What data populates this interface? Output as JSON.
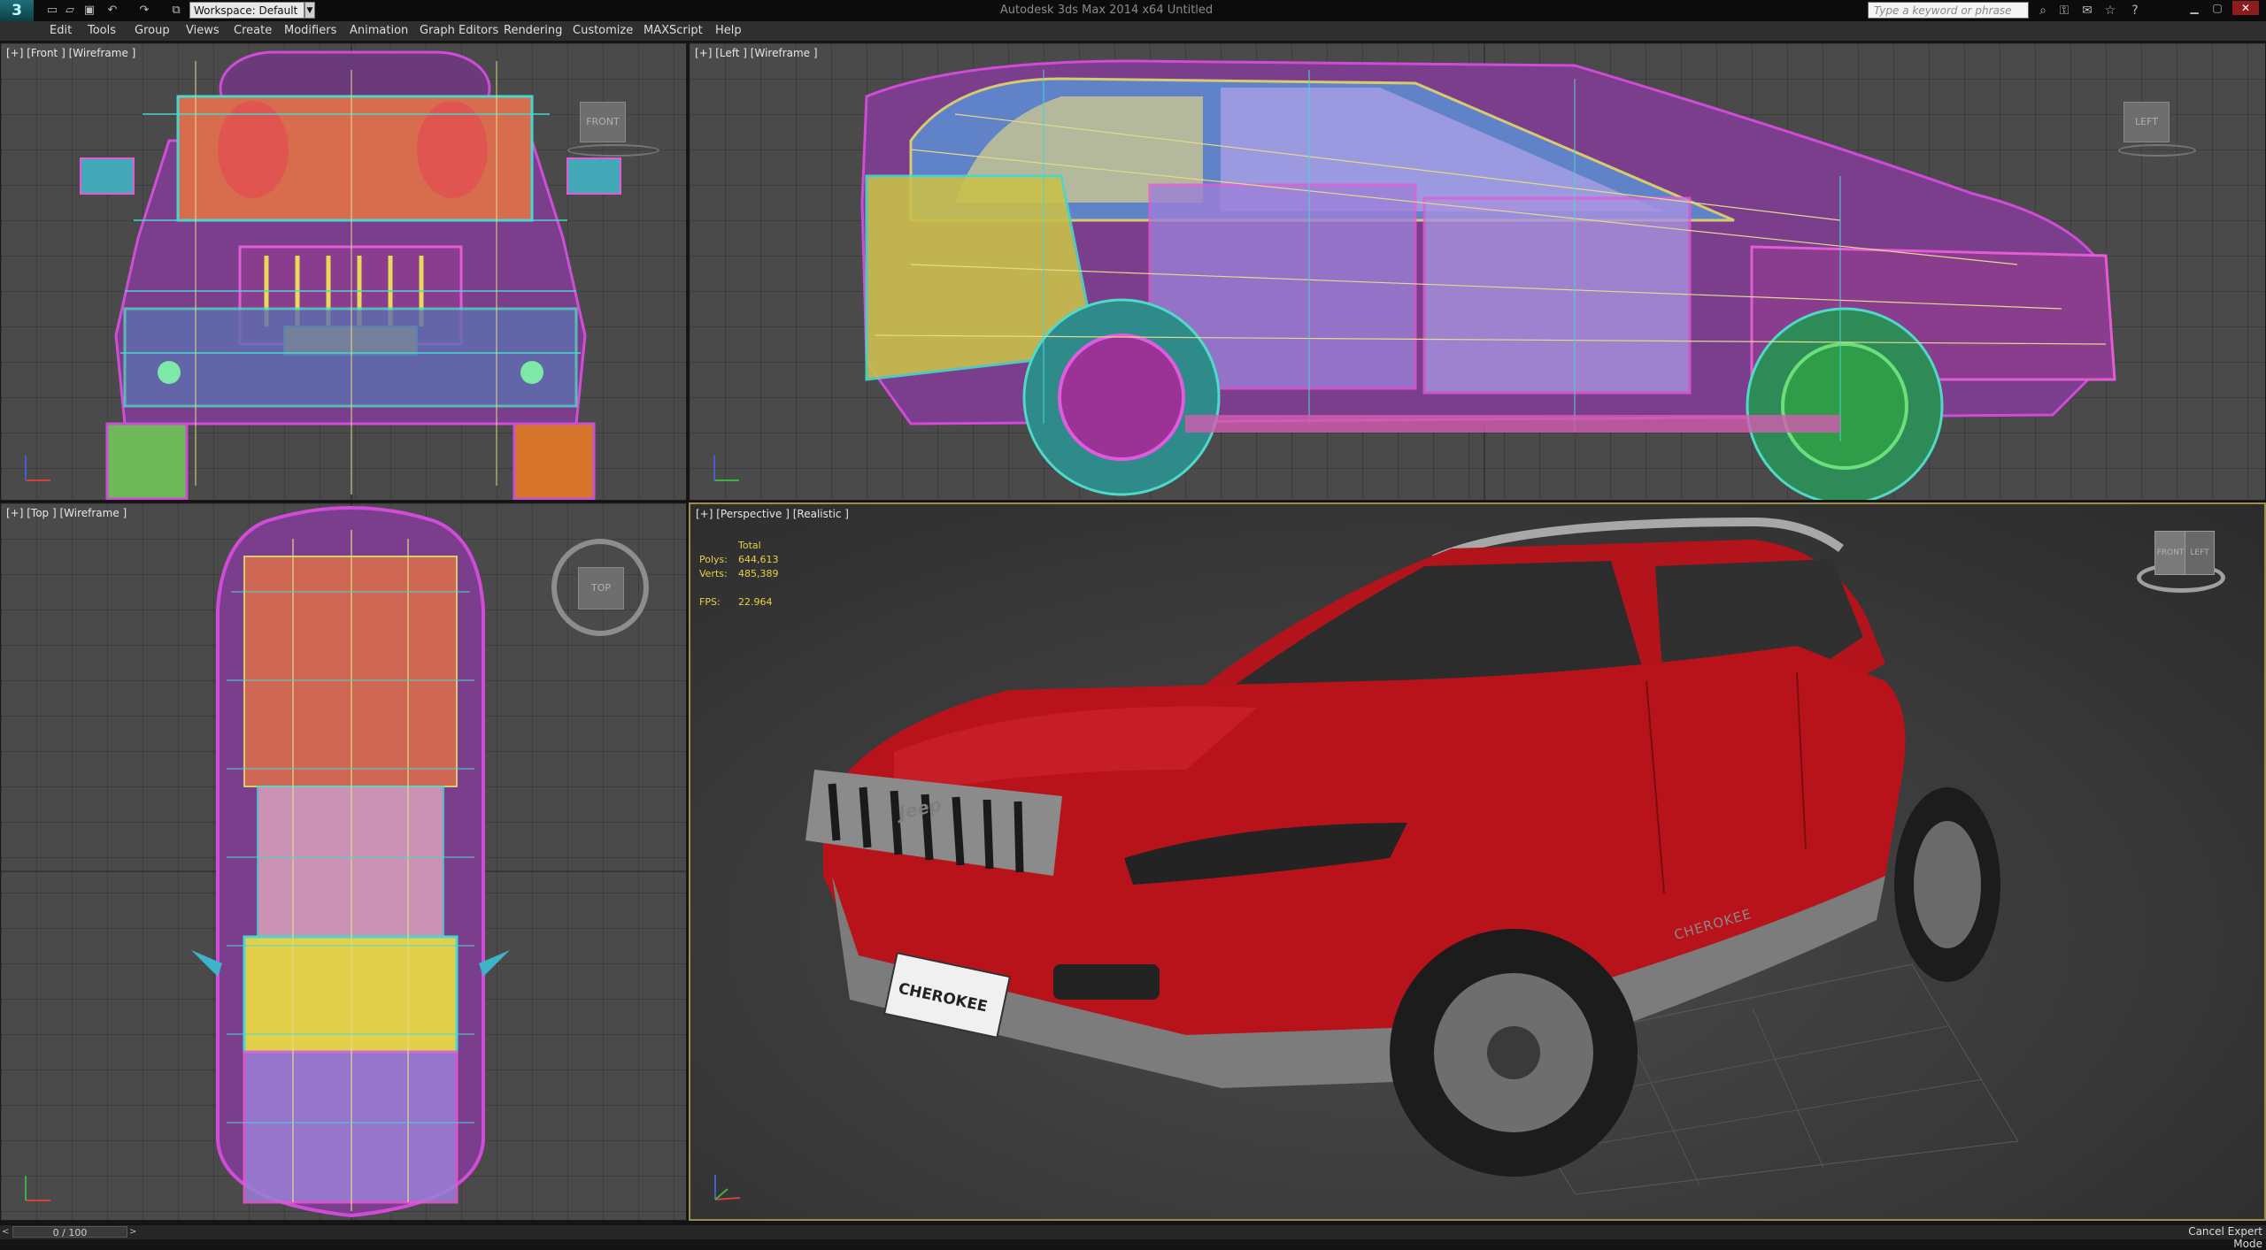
{
  "app": {
    "title": "Autodesk 3ds Max 2014 x64     Untitled",
    "logo": "3"
  },
  "toolbar": {
    "workspace": "Workspace: Default",
    "search_placeholder": "Type a keyword or phrase"
  },
  "quick_access_icons": [
    "new-file-icon",
    "open-icon",
    "save-icon",
    "undo-icon",
    "redo-icon",
    "project-folder-icon"
  ],
  "title_icons": [
    "binoculars-icon",
    "key-icon",
    "communication-icon",
    "favorites-icon",
    "help-icon"
  ],
  "menu": {
    "items": [
      "Edit",
      "Tools",
      "Group",
      "Views",
      "Create",
      "Modifiers",
      "Animation",
      "Graph Editors",
      "Rendering",
      "Customize",
      "MAXScript",
      "Help"
    ]
  },
  "viewports": {
    "front": {
      "label": "[+] [Front ] [Wireframe ]",
      "cube": "FRONT"
    },
    "left": {
      "label": "[+] [Left ] [Wireframe ]",
      "cube": "LEFT"
    },
    "top": {
      "label": "[+] [Top ] [Wireframe ]",
      "cube": "TOP"
    },
    "perspective": {
      "label": "[+] [Perspective ] [Realistic ]",
      "cube_front": "FRONT",
      "cube_left": "LEFT"
    }
  },
  "stats": {
    "total": "Total",
    "polys_label": "Polys:",
    "polys": "644,613",
    "verts_label": "Verts:",
    "verts": "485,389",
    "fps_label": "FPS:",
    "fps": "22.964"
  },
  "car": {
    "brand": "Jeep",
    "model": "CHEROKEE",
    "body_color": "#b8131b"
  },
  "statusbar": {
    "frame": "0 / 100",
    "expert": "Cancel Expert Mode"
  },
  "colors": {
    "viewport_bg": "#4a4a4a",
    "active_border": "#9c8c4e",
    "stat_text": "#e5d24a"
  }
}
